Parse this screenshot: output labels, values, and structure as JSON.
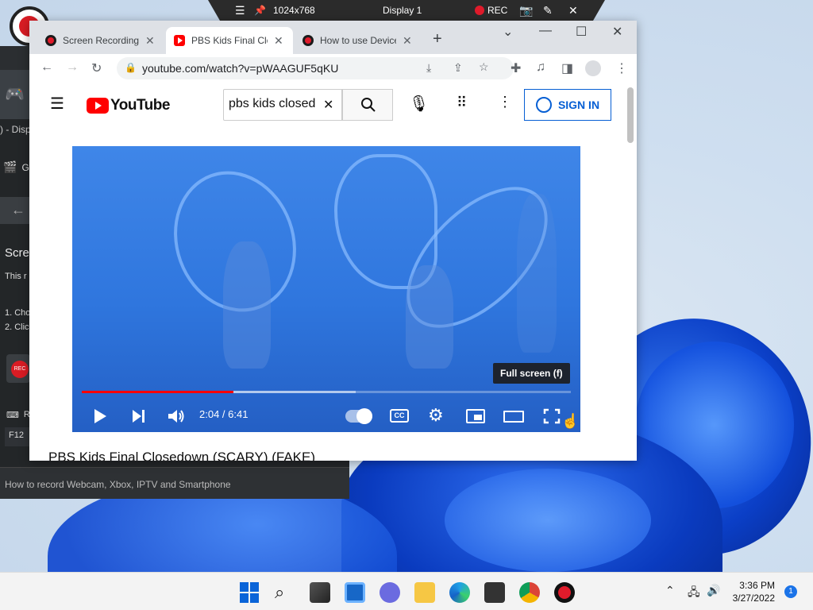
{
  "recorder_bar": {
    "resolution": "1024x768",
    "display": "Display 1",
    "rec_label": "REC"
  },
  "background_app": {
    "tab_fragment": ") - Disp",
    "menu_item_fragment": "G",
    "heading_fragment": "Scre",
    "line1_fragment": "This r",
    "step1_fragment": "1. Cho",
    "step2_fragment": "2. Clic",
    "rec_button_fragment": "REC",
    "hotkey_label_fragment": "R",
    "hotkey_value": "F12",
    "status_text": "How to record Webcam, Xbox, IPTV and Smartphone"
  },
  "browser": {
    "tabs": [
      {
        "title": "Screen Recording",
        "active": false
      },
      {
        "title": "PBS Kids Final Clo",
        "active": true
      },
      {
        "title": "How to use Device",
        "active": false
      }
    ],
    "url": "youtube.com/watch?v=pWAAGUF5qKU"
  },
  "youtube": {
    "logo_text": "YouTube",
    "search_value": "pbs kids closed",
    "sign_in_label": "SIGN IN",
    "tooltip": "Full screen (f)",
    "time": "2:04 / 6:41",
    "progress_fraction": 0.31,
    "buffered_fraction": 0.56,
    "video_title": "PBS Kids Final Closedown (SCARY) (FAKE)"
  },
  "taskbar": {
    "time": "3:36 PM",
    "date": "3/27/2022",
    "notifications": "1"
  },
  "colors": {
    "youtube_red": "#ff0000",
    "signin_blue": "#065fd4",
    "rec_red": "#e01b2b"
  }
}
